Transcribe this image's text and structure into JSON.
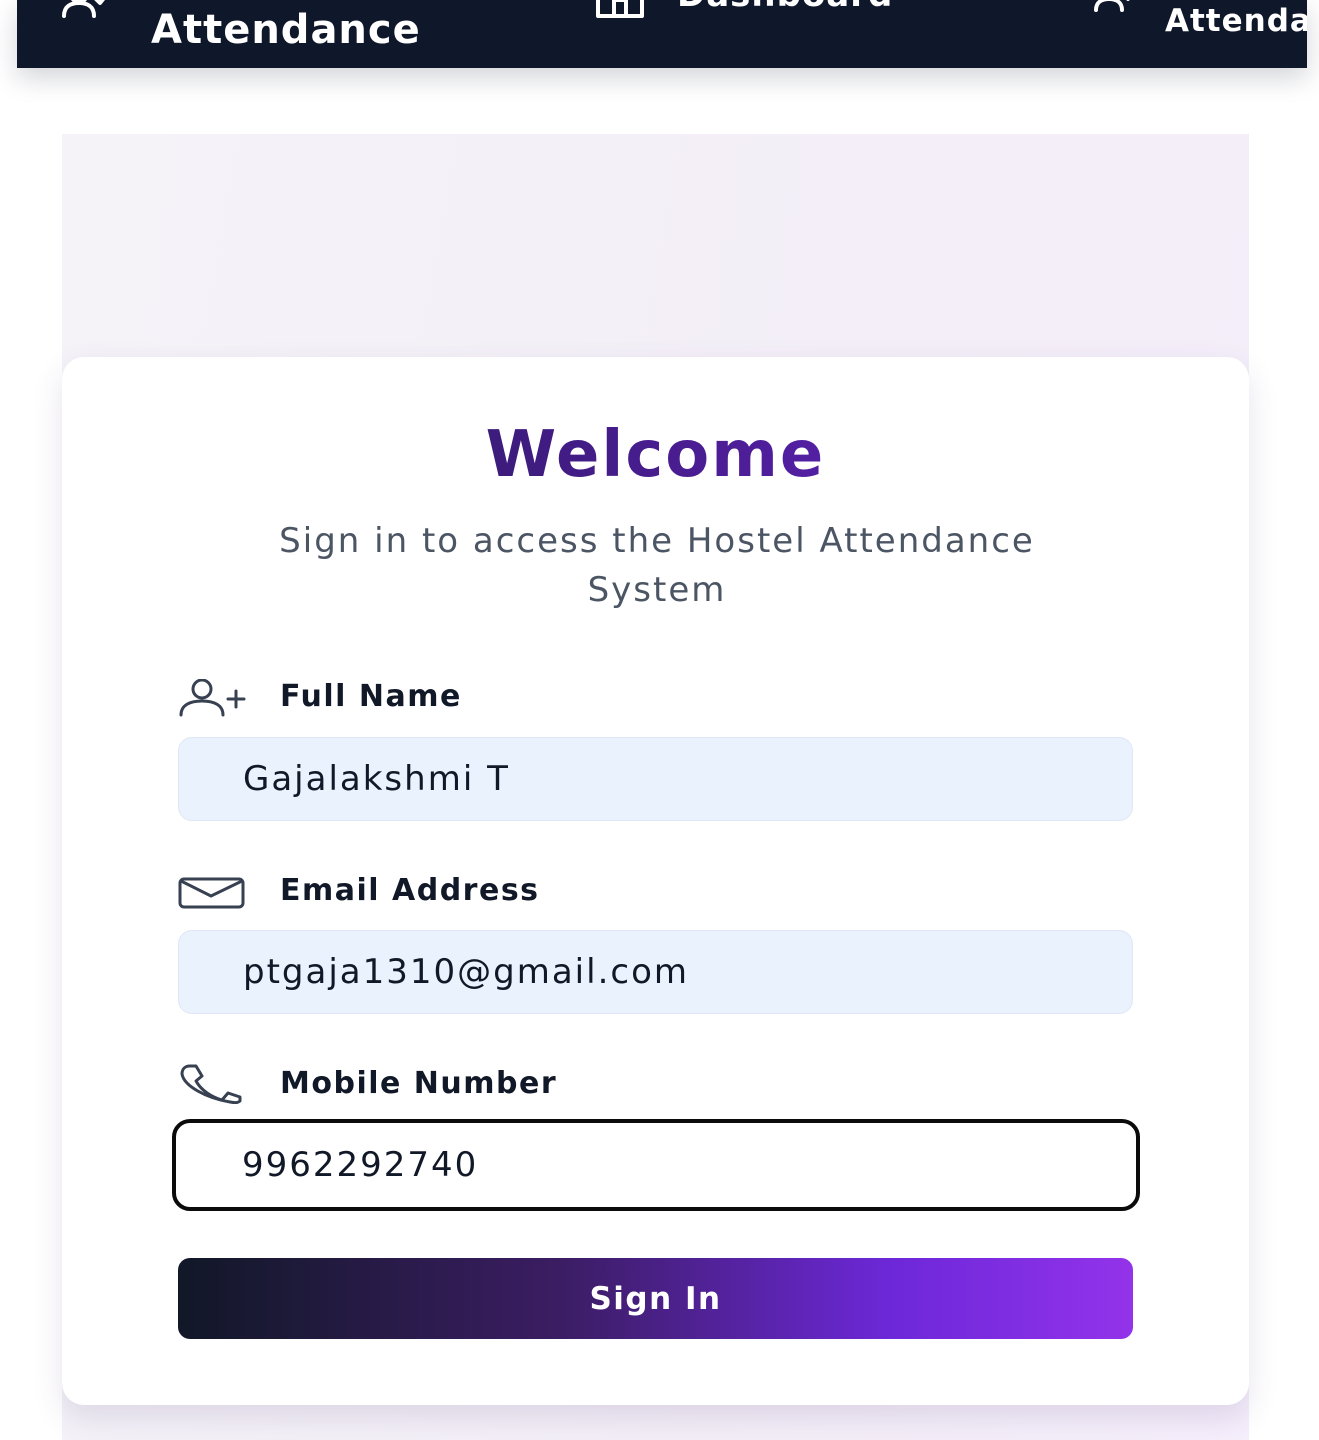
{
  "nav": {
    "brand": {
      "title": "Attendance",
      "icon": "user-check-icon"
    },
    "dashboard": {
      "label": "Dashboard",
      "icon": "home-icon"
    },
    "attendance": {
      "label": "Attenda",
      "icon": "user-check-icon"
    }
  },
  "card": {
    "title": "Welcome",
    "subtitle": "Sign in to access the Hostel Attendance System"
  },
  "form": {
    "full_name": {
      "label": "Full Name",
      "icon": "user-plus-icon",
      "value": "Gajalakshmi T"
    },
    "email": {
      "label": "Email Address",
      "icon": "mail-icon",
      "value": "ptgaja1310@gmail.com"
    },
    "mobile": {
      "label": "Mobile Number",
      "icon": "phone-icon",
      "value": "9962292740"
    },
    "submit_label": "Sign In"
  },
  "colors": {
    "nav_background": "#0f172a",
    "title_gradient_start": "#1e1b4b",
    "title_gradient_end": "#6d28d9",
    "input_background": "#eaf2fe",
    "button_gradient_start": "#111827",
    "button_gradient_end": "#9333ea"
  }
}
